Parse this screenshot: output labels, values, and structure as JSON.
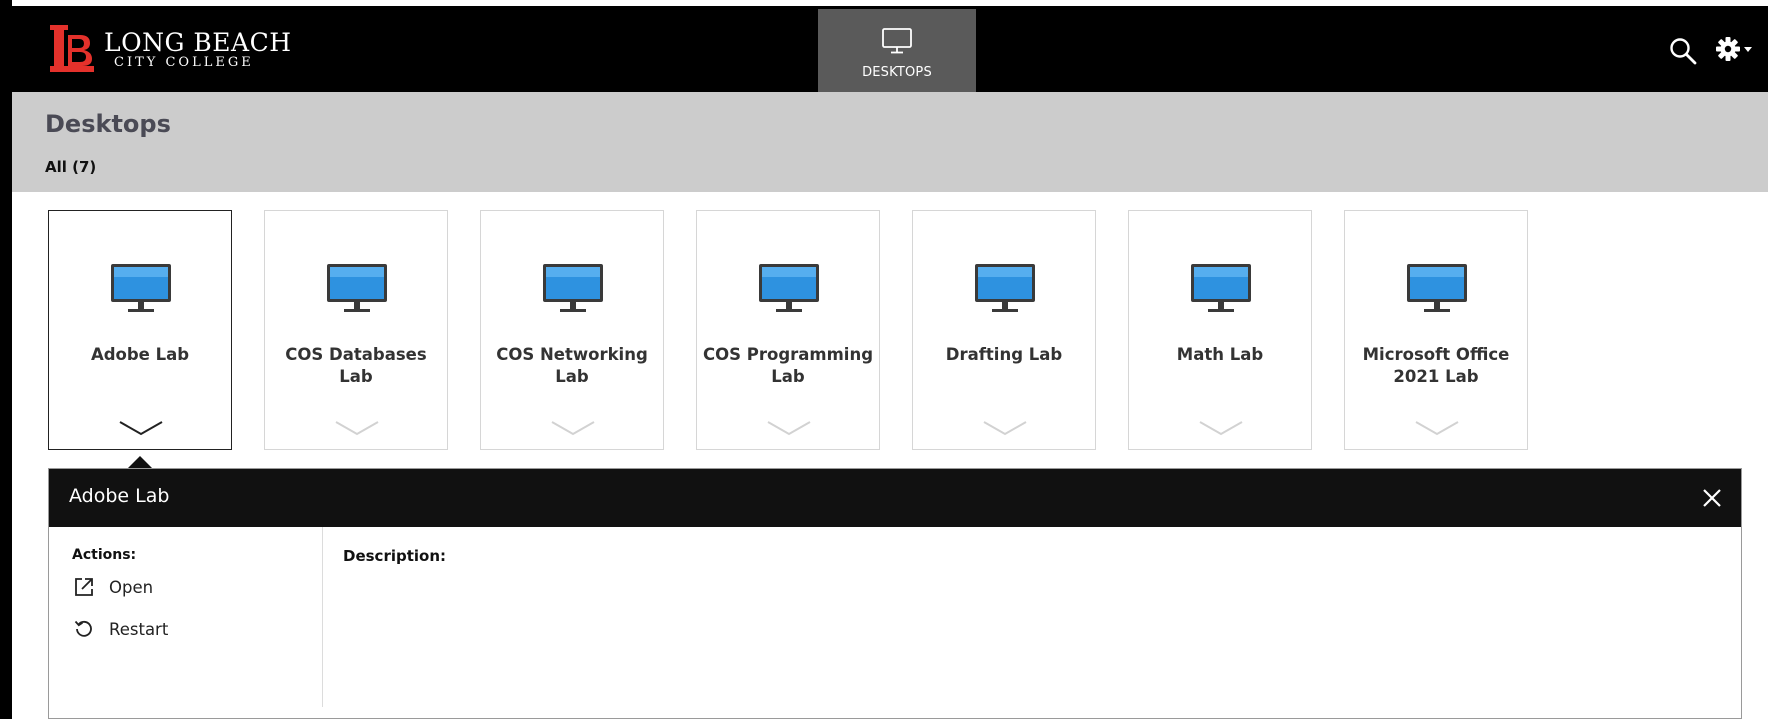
{
  "brand": {
    "logo_line1": "LONG BEACH",
    "logo_line2": "CITY COLLEGE",
    "color": "#e4312b"
  },
  "nav": {
    "tab_label": "DESKTOPS",
    "tab_icon": "monitor-icon",
    "tab_bg": "#5a5a5a"
  },
  "header": {
    "title": "Desktops",
    "filter_label": "All (7)",
    "bg": "#cccccc"
  },
  "desktops": [
    {
      "label": "Adobe Lab",
      "selected": true
    },
    {
      "label": "COS Databases Lab",
      "selected": false
    },
    {
      "label": "COS Networking Lab",
      "selected": false
    },
    {
      "label": "COS Programming Lab",
      "selected": false
    },
    {
      "label": "Drafting Lab",
      "selected": false
    },
    {
      "label": "Math Lab",
      "selected": false
    },
    {
      "label": "Microsoft Office 2021 Lab",
      "selected": false
    }
  ],
  "detail": {
    "title": "Adobe Lab",
    "actions_label": "Actions:",
    "actions": [
      {
        "label": "Open",
        "icon": "external-link-icon"
      },
      {
        "label": "Restart",
        "icon": "restart-icon"
      }
    ],
    "description_label": "Description:"
  },
  "colors": {
    "topbar": "#000000",
    "monitor_screen": "#2e92e0",
    "monitor_frame": "#3a3a3a"
  }
}
